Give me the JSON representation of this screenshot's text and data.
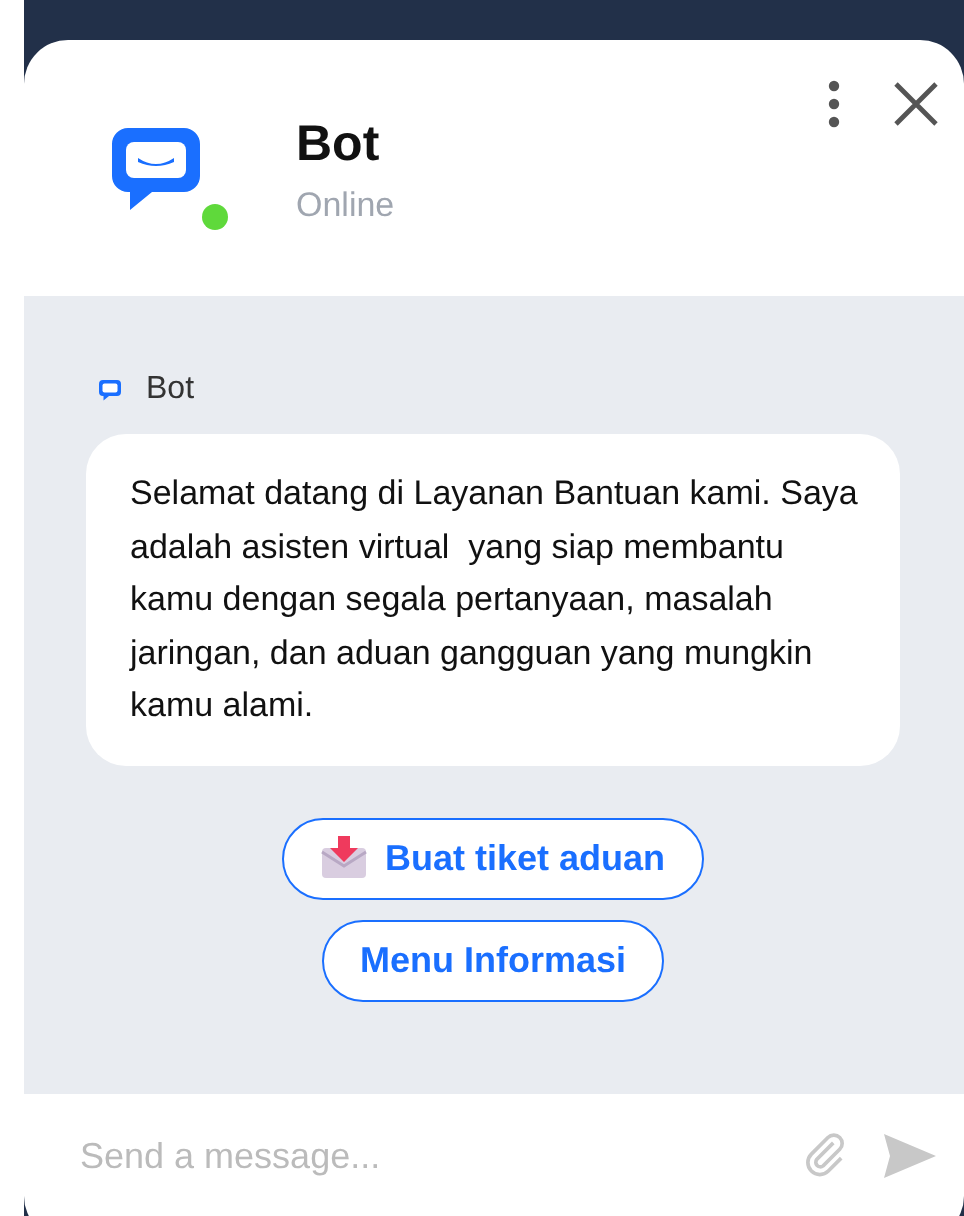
{
  "header": {
    "name": "Bot",
    "status": "Online",
    "online": true
  },
  "messages": [
    {
      "sender": "Bot",
      "text": "Selamat datang di Layanan Bantuan kami. Saya adalah asisten virtual  yang siap membantu kamu dengan segala pertanyaan, masalah jaringan, dan aduan gangguan yang mungkin kamu alami."
    }
  ],
  "quick_replies": [
    {
      "label": "Buat tiket aduan",
      "kind": "envelope"
    },
    {
      "label": "Menu Informasi",
      "kind": "plain"
    }
  ],
  "composer": {
    "placeholder": "Send a message..."
  }
}
